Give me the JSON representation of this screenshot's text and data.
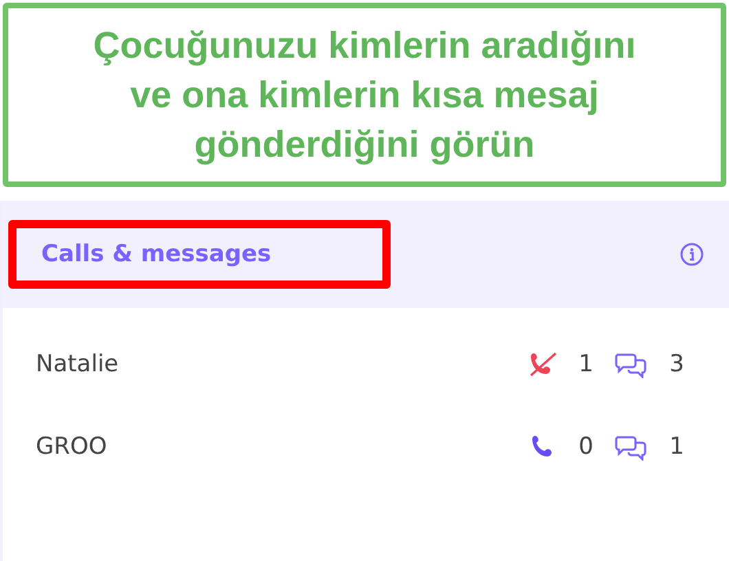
{
  "caption": {
    "lines": [
      "Çocuğunuzu kimlerin aradığını",
      "ve ona kimlerin kısa mesaj",
      "gönderdiğini görün"
    ]
  },
  "panel": {
    "title": "Calls & messages",
    "title_highlighted": true
  },
  "contacts": [
    {
      "name": "Natalie",
      "missed": true,
      "calls": "1",
      "messages": "3"
    },
    {
      "name": "GROO",
      "missed": false,
      "calls": "0",
      "messages": "1"
    }
  ]
}
